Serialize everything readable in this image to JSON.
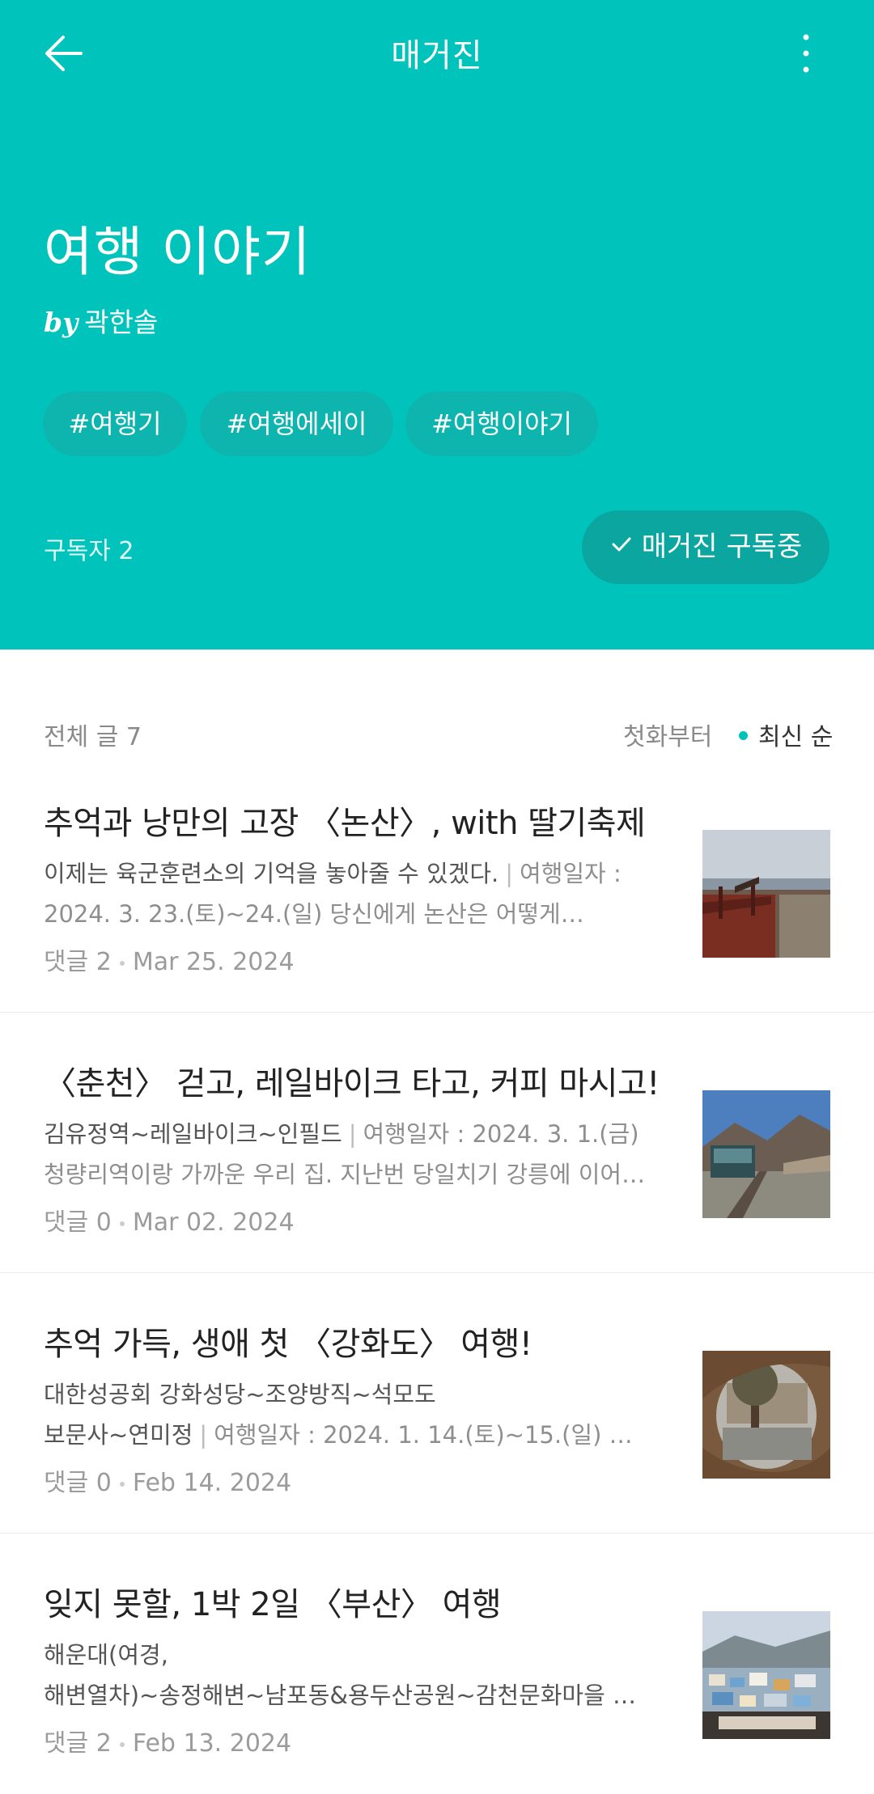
{
  "topbar": {
    "title": "매거진",
    "back_icon": "arrow-left-icon",
    "more_icon": "more-vertical-icon"
  },
  "magazine": {
    "title": "여행 이야기",
    "by_label": "by",
    "author": "곽한솔",
    "tags": [
      "#여행기",
      "#여행에세이",
      "#여행이야기"
    ],
    "subscribers": "구독자 2",
    "subscribe_label": "매거진 구독중"
  },
  "list": {
    "total": "전체 글 7",
    "sort_first": "첫화부터",
    "sort_latest": "최신 순",
    "articles": [
      {
        "title": "추억과 낭만의 고장 〈논산〉, with 딸기축제",
        "lead": "이제는 육군훈련소의 기억을 놓아줄 수 있겠다.",
        "detail1": "여행일자 :",
        "line2": "2024. 3. 23.(토)~24.(일)  당신에게 논산은 어떻게…",
        "comments": "댓글 2",
        "date": "Mar 25. 2024"
      },
      {
        "title": "〈춘천〉 걷고, 레일바이크 타고, 커피 마시고!",
        "lead": "김유정역~레일바이크~인필드",
        "detail1": "여행일자 : 2024.  3. 1.(금)",
        "line2": "청량리역이랑 가까운 우리 집. 지난번 당일치기 강릉에 이어…",
        "comments": "댓글 0",
        "date": "Mar 02. 2024"
      },
      {
        "title": "추억 가득, 생애 첫 〈강화도〉 여행!",
        "lead": "대한성공회 강화성당~조양방직~석모도",
        "lead2": "보문사~연미정",
        "detail2": "여행일자 : 2024. 1. 14.(토)~15.(일)  …",
        "comments": "댓글 0",
        "date": "Feb 14. 2024"
      },
      {
        "title": "잊지 못할, 1박 2일 〈부산〉 여행",
        "lead": "해운대(여경,",
        "lead2": "해변열차)~송정해변~남포동&용두산공원~감천문화마을 …",
        "comments": "댓글 2",
        "date": "Feb 13. 2024"
      }
    ]
  },
  "colors": {
    "header_bg": "#00c4bc",
    "tag_bg": "#0db5ae",
    "button_bg": "#0aa69f",
    "accent_dot": "#00c4bc"
  }
}
